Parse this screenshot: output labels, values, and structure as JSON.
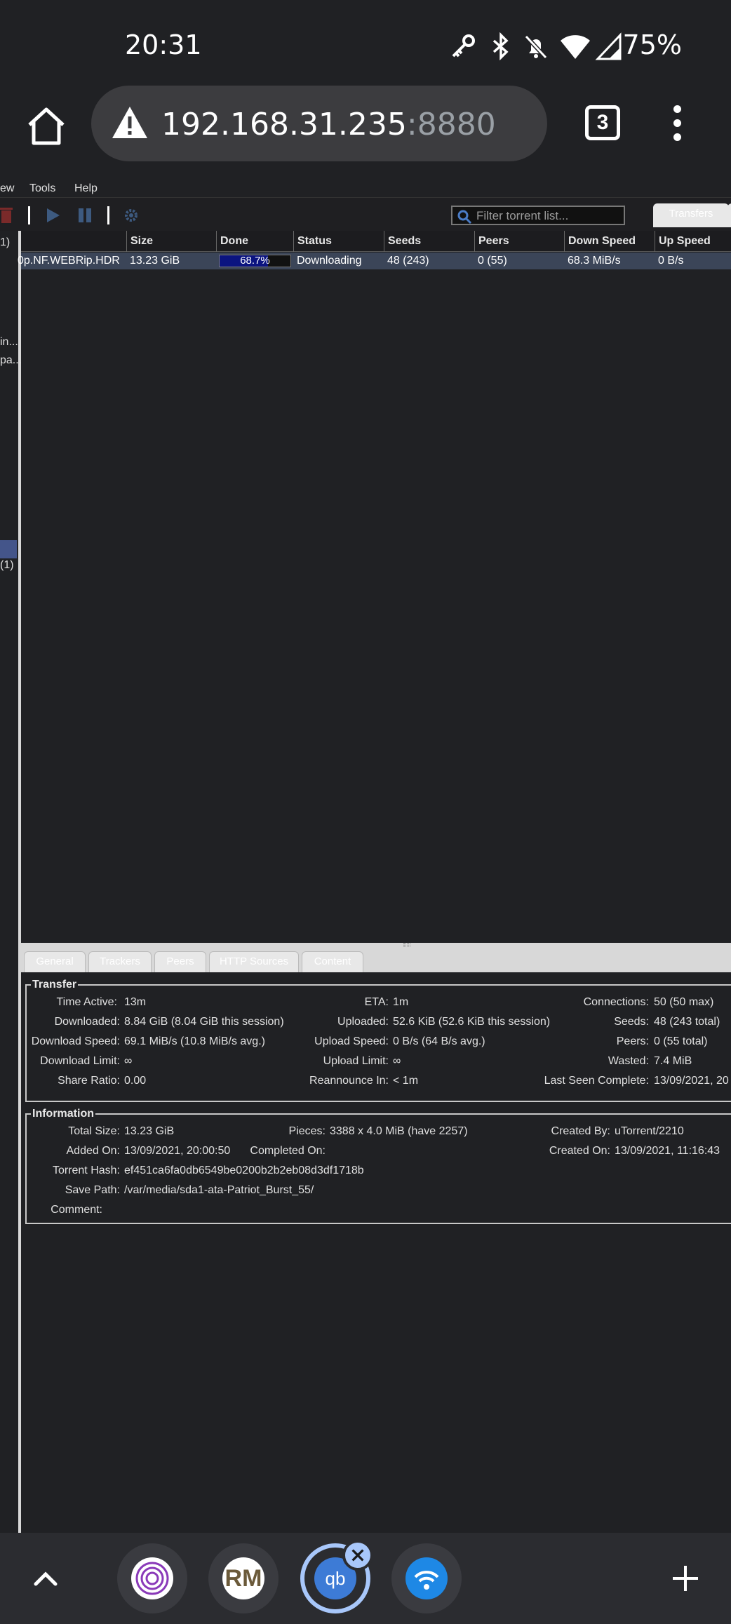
{
  "status_bar": {
    "time": "20:31",
    "battery": "75%"
  },
  "browser": {
    "url_host": "192.168.31.235",
    "url_port": ":8880",
    "tab_count": "3"
  },
  "menubar": {
    "items": [
      "ew",
      "Tools",
      "Help"
    ]
  },
  "filter": {
    "placeholder": "Filter torrent list..."
  },
  "top_tab": {
    "label": "Transfers"
  },
  "sidebar": {
    "labels": [
      "1)",
      "in...",
      "pa...",
      "(1)"
    ]
  },
  "torrent_table": {
    "headers": [
      "Size",
      "Done",
      "Status",
      "Seeds",
      "Peers",
      "Down Speed",
      "Up Speed"
    ],
    "row": {
      "name": "0p.NF.WEBRip.HDR....",
      "size": "13.23 GiB",
      "done": "68.7%",
      "progress": 0.687,
      "status": "Downloading",
      "seeds": "48 (243)",
      "peers": "0 (55)",
      "down_speed": "68.3 MiB/s",
      "up_speed": "0 B/s"
    }
  },
  "properties": {
    "tabs": [
      "General",
      "Trackers",
      "Peers",
      "HTTP Sources",
      "Content"
    ],
    "transfer": {
      "legend": "Transfer",
      "time_active_label": "Time Active:",
      "time_active": "13m",
      "eta_label": "ETA:",
      "eta": "1m",
      "connections_label": "Connections:",
      "connections": "50 (50 max)",
      "downloaded_label": "Downloaded:",
      "downloaded": "8.84 GiB (8.04 GiB this session)",
      "uploaded_label": "Uploaded:",
      "uploaded": "52.6 KiB (52.6 KiB this session)",
      "seeds_label": "Seeds:",
      "seeds": "48 (243 total)",
      "download_speed_label": "Download Speed:",
      "download_speed": "69.1 MiB/s (10.8 MiB/s avg.)",
      "upload_speed_label": "Upload Speed:",
      "upload_speed": "0 B/s (64 B/s avg.)",
      "peers_label": "Peers:",
      "peers": "0 (55 total)",
      "download_limit_label": "Download Limit:",
      "download_limit": "∞",
      "upload_limit_label": "Upload Limit:",
      "upload_limit": "∞",
      "wasted_label": "Wasted:",
      "wasted": "7.4 MiB",
      "share_ratio_label": "Share Ratio:",
      "share_ratio": "0.00",
      "reannounce_label": "Reannounce In:",
      "reannounce": "< 1m",
      "last_seen_label": "Last Seen Complete:",
      "last_seen": "13/09/2021, 20"
    },
    "information": {
      "legend": "Information",
      "total_size_label": "Total Size:",
      "total_size": "13.23 GiB",
      "pieces_label": "Pieces:",
      "pieces": "3388 x 4.0 MiB (have 2257)",
      "created_by_label": "Created By:",
      "created_by": "uTorrent/2210",
      "added_on_label": "Added On:",
      "added_on": "13/09/2021, 20:00:50",
      "completed_on_label": "Completed On:",
      "completed_on": "",
      "created_on_label": "Created On:",
      "created_on": "13/09/2021, 11:16:43",
      "hash_label": "Torrent Hash:",
      "hash": "ef451ca6fa0db6549be0200b2b2eb08d3df1718b",
      "save_path_label": "Save Path:",
      "save_path": "/var/media/sda1-ata-Patriot_Burst_55/",
      "comment_label": "Comment:",
      "comment": ""
    }
  },
  "bubbles": {
    "rm_label": "RM",
    "qb_label": "qb"
  },
  "colors": {
    "accent": "#a8c7fa",
    "row_selected": "#3b4558",
    "progress_fill": "#0b1480"
  }
}
